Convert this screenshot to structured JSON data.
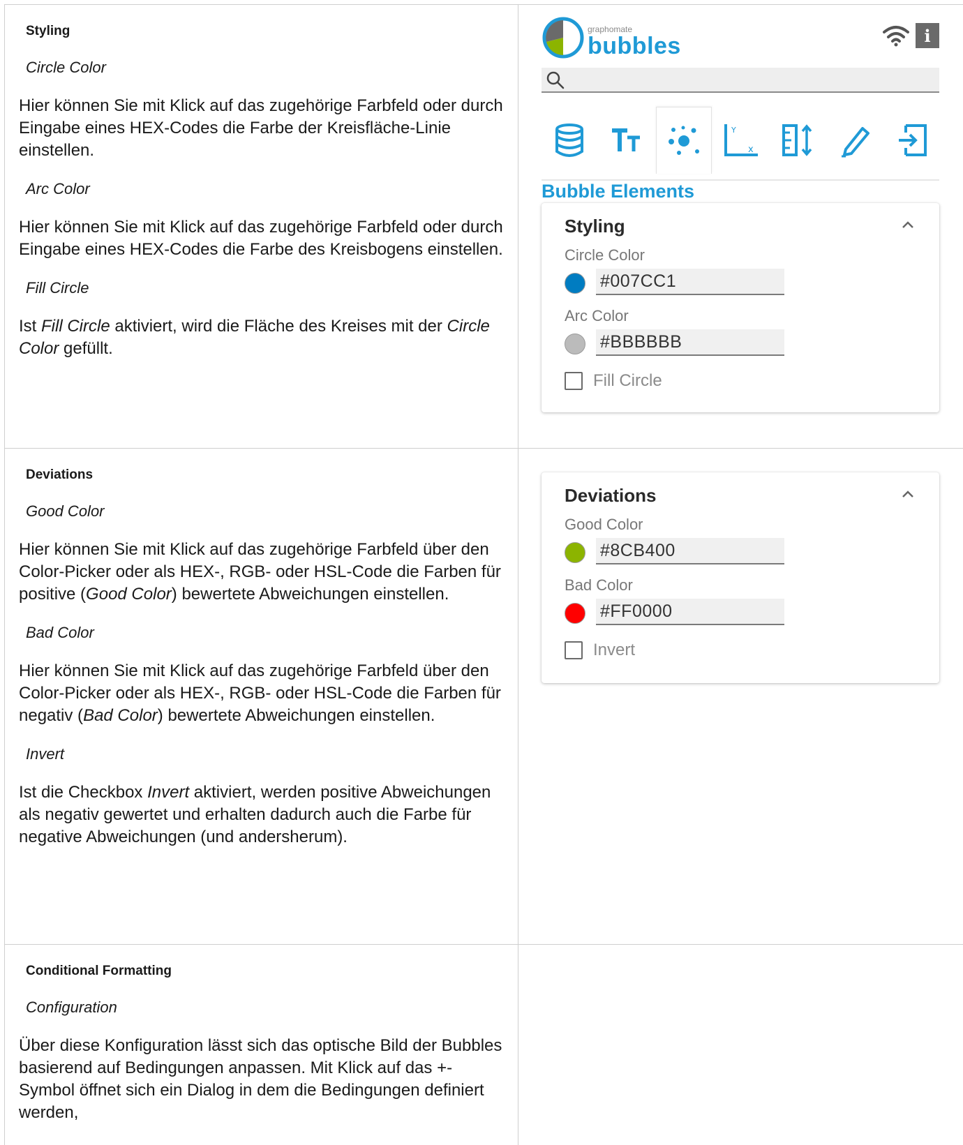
{
  "row1": {
    "heading": "Styling",
    "circle_color": {
      "title": "Circle Color",
      "text": "Hier können Sie mit Klick auf das zugehörige Farbfeld oder durch Eingabe eines HEX-Codes die Farbe der Kreisfläche-Linie einstellen."
    },
    "arc_color": {
      "title": "Arc Color",
      "text": "Hier können Sie mit Klick auf das zugehörige Farbfeld oder durch Eingabe eines HEX-Codes die Farbe des Kreisbogens einstellen."
    },
    "fill_circle": {
      "title": "Fill Circle",
      "text_pre": "Ist ",
      "text_em1": "Fill Circle",
      "text_mid": " aktiviert, wird die Fläche des Kreises mit der ",
      "text_em2": "Circle Color",
      "text_post": " gefüllt."
    }
  },
  "row2": {
    "heading": "Deviations",
    "good_color": {
      "title": "Good Color",
      "text_pre": "Hier können Sie mit Klick auf das zugehörige Farbfeld über den Color-Picker oder als HEX-, RGB- oder HSL-Code die Farben für positive (",
      "text_em": "Good Color",
      "text_post": ") bewertete Abweichungen einstellen."
    },
    "bad_color": {
      "title": "Bad Color",
      "text_pre": "Hier können Sie mit Klick auf das zugehörige Farbfeld über den Color-Picker oder als HEX-, RGB- oder HSL-Code die Farben für negativ (",
      "text_em": "Bad Color",
      "text_post": ") bewertete Abweichungen einstellen."
    },
    "invert": {
      "title": "Invert",
      "text_pre": "Ist die Checkbox ",
      "text_em": "Invert",
      "text_post": " aktiviert, werden positive Abweichungen als negativ gewertet und erhalten dadurch auch die Farbe für negative Abweichungen (und andersherum)."
    }
  },
  "row3": {
    "heading": "Conditional Formatting",
    "configuration": {
      "title": "Configuration",
      "text": "Über diese Konfiguration lässt sich das optische Bild der Bubbles basierend auf Bedingungen anpassen. Mit Klick auf das +- Symbol öffnet sich ein Dialog in dem die Bedingungen definiert werden,"
    }
  },
  "panel": {
    "logo_small": "graphomate",
    "logo_big": "bubbles",
    "info_label": "i",
    "search_placeholder": "",
    "tabs": [
      "data-icon",
      "text-icon",
      "bubble-elements-icon",
      "axis-icon",
      "scale-icon",
      "highlight-icon",
      "export-icon"
    ],
    "active_tab": 2,
    "section_title": "Bubble Elements",
    "styling_card": {
      "title": "Styling",
      "circle_label": "Circle Color",
      "circle_hex": "#007CC1",
      "circle_color": "#007CC1",
      "arc_label": "Arc Color",
      "arc_hex": "#BBBBBB",
      "arc_color": "#BBBBBB",
      "fill_label": "Fill Circle",
      "fill_checked": false
    },
    "deviations_card": {
      "title": "Deviations",
      "good_label": "Good Color",
      "good_hex": "#8CB400",
      "good_color": "#8CB400",
      "bad_label": "Bad Color",
      "bad_hex": "#FF0000",
      "bad_color": "#FF0000",
      "invert_label": "Invert",
      "invert_checked": false
    },
    "accent_color": "#1F9AD6"
  }
}
